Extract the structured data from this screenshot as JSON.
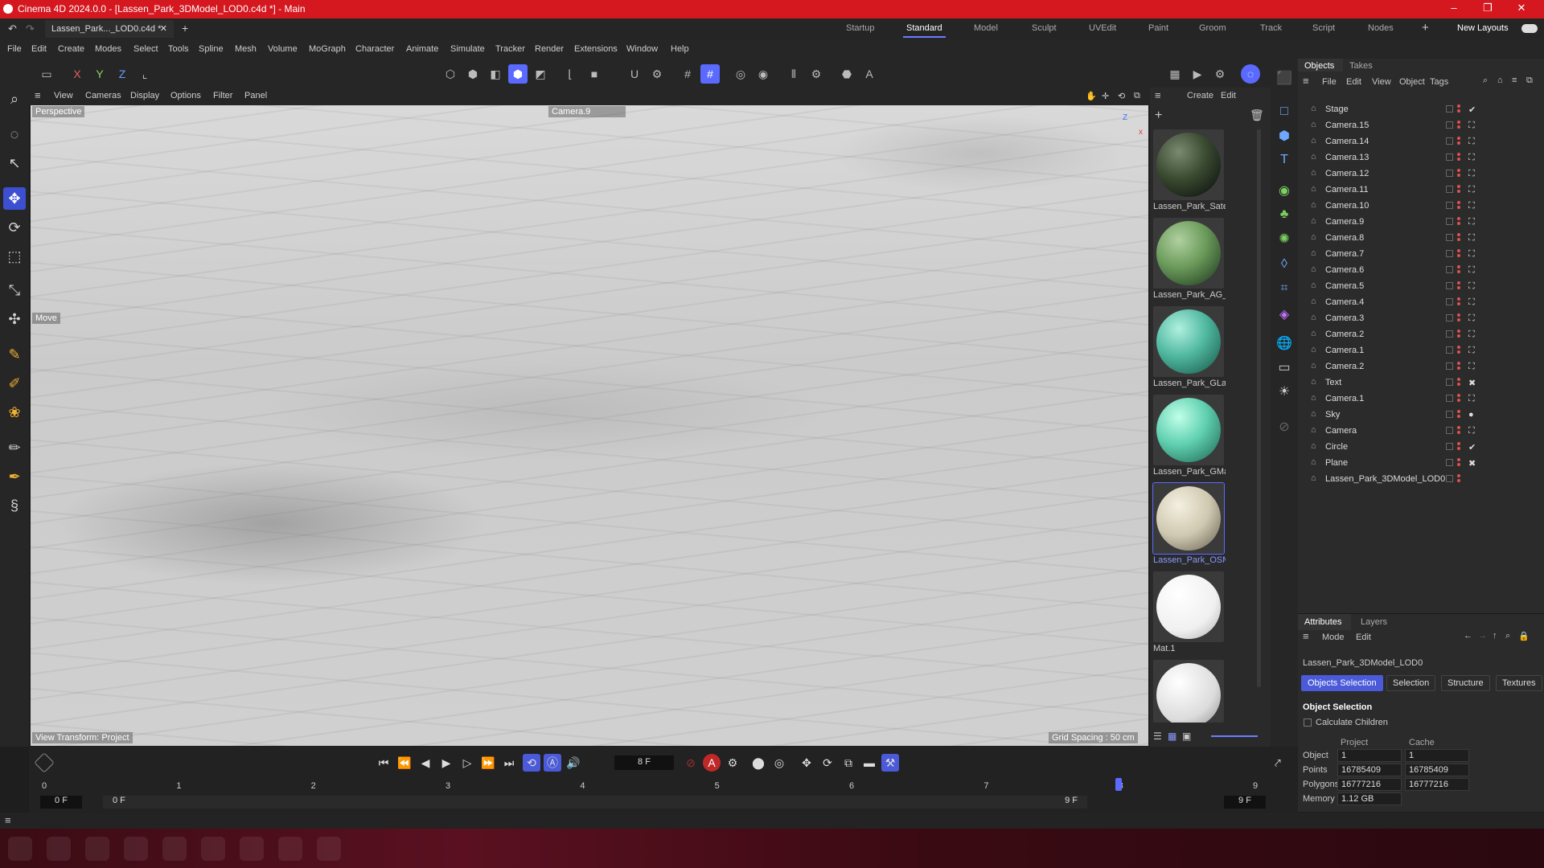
{
  "window": {
    "title": "Cinema 4D 2024.0.0 - [Lassen_Park_3DModel_LOD0.c4d *] - Main",
    "minimize": "–",
    "restore": "❐",
    "close": "✕"
  },
  "tabs": {
    "doc_tab": "Lassen_Park..._LOD0.c4d *",
    "add": "+",
    "layouts": [
      "Startup",
      "Standard",
      "Model",
      "Sculpt",
      "UVEdit",
      "Paint",
      "Groom",
      "Track",
      "Script",
      "Nodes"
    ],
    "active_layout": "Standard",
    "new_layouts": "New Layouts"
  },
  "menu": [
    "File",
    "Edit",
    "Create",
    "Modes",
    "Select",
    "Tools",
    "Spline",
    "Mesh",
    "Volume",
    "MoGraph",
    "Character",
    "Animate",
    "Simulate",
    "Tracker",
    "Render",
    "Extensions",
    "Window",
    "Help"
  ],
  "axes": {
    "x": "X",
    "y": "Y",
    "z": "Z"
  },
  "viewport": {
    "menu": [
      "View",
      "Cameras",
      "Display",
      "Options",
      "Filter",
      "Panel"
    ],
    "projection": "Perspective",
    "camera": "Camera.9",
    "tool_label": "Move",
    "view_transform": "View Transform: Project",
    "grid_spacing": "Grid Spacing : 50 cm",
    "axis_z": "Z",
    "axis_x": "x"
  },
  "materials": {
    "menu": [
      "Create",
      "Edit"
    ],
    "items": [
      "Lassen_Park_Satel",
      "Lassen_Park_AG_L",
      "Lassen_Park_GLan",
      "Lassen_Park_GMa",
      "Lassen_Park_OSM",
      "Mat.1",
      ""
    ],
    "active": "Lassen_Park_OSM"
  },
  "objects": {
    "tabs": [
      "Objects",
      "Takes"
    ],
    "menu": [
      "File",
      "Edit",
      "View",
      "Object",
      "Tags"
    ],
    "rows": [
      {
        "name": "Stage",
        "tag": "✔"
      },
      {
        "name": "Camera.15",
        "tag": "⛶"
      },
      {
        "name": "Camera.14",
        "tag": "⛶"
      },
      {
        "name": "Camera.13",
        "tag": "⛶"
      },
      {
        "name": "Camera.12",
        "tag": "⛶"
      },
      {
        "name": "Camera.11",
        "tag": "⛶"
      },
      {
        "name": "Camera.10",
        "tag": "⛶"
      },
      {
        "name": "Camera.9",
        "tag": "⛶"
      },
      {
        "name": "Camera.8",
        "tag": "⛶"
      },
      {
        "name": "Camera.7",
        "tag": "⛶"
      },
      {
        "name": "Camera.6",
        "tag": "⛶"
      },
      {
        "name": "Camera.5",
        "tag": "⛶"
      },
      {
        "name": "Camera.4",
        "tag": "⛶"
      },
      {
        "name": "Camera.3",
        "tag": "⛶"
      },
      {
        "name": "Camera.2",
        "tag": "⛶"
      },
      {
        "name": "Camera.1",
        "tag": "⛶"
      },
      {
        "name": "Camera.2",
        "tag": "⛶"
      },
      {
        "name": "Text",
        "tag": "✖"
      },
      {
        "name": "Camera.1",
        "tag": "⛶"
      },
      {
        "name": "Sky",
        "tag": "●"
      },
      {
        "name": "Camera",
        "tag": "⛶"
      },
      {
        "name": "Circle",
        "tag": "✔"
      },
      {
        "name": "Plane",
        "tag": "✖"
      },
      {
        "name": "Lassen_Park_3DModel_LOD0",
        "tag": ""
      }
    ]
  },
  "attributes": {
    "tabs": [
      "Attributes",
      "Layers"
    ],
    "menu": [
      "Mode",
      "Edit"
    ],
    "object_name": "Lassen_Park_3DModel_LOD0",
    "sub_tabs": [
      "Objects Selection",
      "Selection",
      "Structure",
      "Textures"
    ],
    "section": "Object Selection",
    "calc_children": "Calculate Children",
    "col_project": "Project",
    "col_cache": "Cache",
    "rows": [
      {
        "label": "Object",
        "project": "1",
        "cache": "1"
      },
      {
        "label": "Points",
        "project": "16785409",
        "cache": "16785409"
      },
      {
        "label": "Polygons",
        "project": "16777216",
        "cache": "16777216"
      },
      {
        "label": "Memory",
        "project": "1.12 GB",
        "cache": ""
      }
    ]
  },
  "timeline": {
    "current_frame": "8 F",
    "ticks": [
      "0",
      "1",
      "2",
      "3",
      "4",
      "5",
      "6",
      "7",
      "8",
      "9"
    ],
    "start": "0 F",
    "start2": "0 F",
    "end": "9 F",
    "end2": "9 F",
    "playhead": 8,
    "max": 9
  }
}
